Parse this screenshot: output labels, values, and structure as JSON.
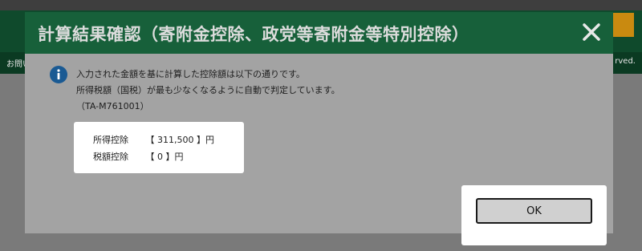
{
  "background": {
    "left_text": "お問い",
    "right_text": "rved."
  },
  "dialog": {
    "title": "計算結果確認（寄附金控除、政党等寄附金等特別控除）",
    "close_icon": "close-icon",
    "info_icon": "info-icon",
    "messages": [
      "入力された金額を基に計算した控除額は以下の通りです。",
      "所得税額（国税）が最も少なくなるように自動で判定しています。",
      "（TA-M761001）"
    ],
    "results": [
      {
        "label": "所得控除",
        "value": "【 311,500 】円"
      },
      {
        "label": "税額控除",
        "value": "【 0 】円"
      }
    ],
    "ok_label": "OK"
  },
  "colors": {
    "header_green": "#17603a",
    "info_blue": "#1a5a93",
    "overlay_gray": "#a3a3a3"
  }
}
